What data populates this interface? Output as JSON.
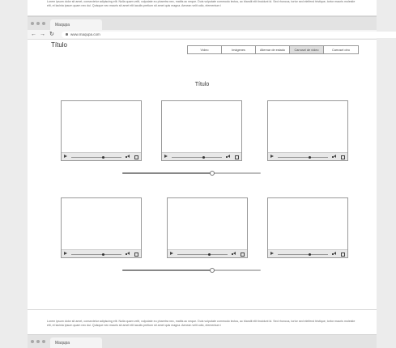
{
  "top_note": {
    "text": "Lorem ipsum dolor sit amet, consectetur adipiscing elit. Nulla quam velit, vulputate eu pharetra nec, mattis ac neque. Duis vulputate commodo lectus, ac blandit elit tincidunt id. Sed rhoncus, tortor sed eleifend tristique, tortor mauris molestie elit, et lacinia ipsum quam nec dui. Quisque nec mauris sit amet elit iaculis pretium sit amet quis magna. Aenean velit odio, elementum i"
  },
  "browser": {
    "tab_label": "Maqupa",
    "url": "www.maqupa.com",
    "back_icon": "back-arrow-icon",
    "forward_icon": "forward-arrow-icon",
    "reload_icon": "reload-icon"
  },
  "site": {
    "title": "Título",
    "nav": [
      {
        "label": "Vídeo",
        "active": false
      },
      {
        "label": "Imágenes",
        "active": false
      },
      {
        "label": "Alternar de estado",
        "active": false
      },
      {
        "label": "Carrusel de vídeo",
        "active": true
      },
      {
        "label": "Carrusel otro",
        "active": false
      }
    ]
  },
  "section": {
    "title": "Título"
  },
  "video_rows": [
    {
      "videos": [
        {
          "progress": 0.62
        },
        {
          "progress": 0.62
        },
        {
          "progress": 0.62
        }
      ],
      "slider_value": 0.65
    },
    {
      "videos": [
        {
          "progress": 0.62
        },
        {
          "progress": 0.62
        },
        {
          "progress": 0.62
        }
      ],
      "slider_value": 0.65
    }
  ],
  "footer": {
    "text": "Lorem ipsum dolor sit amet, consectetur adipiscing elit. Nulla quam velit, vulputate eu pharetra nec, mattis ac neque. Duis vulputate commodo lectus, ac blandit elit tincidunt id. Sed rhoncus, tortor sed eleifend tristique, tortor mauris molestie elit, et lacinia ipsum quam nec dui. Quisque nec mauris sit amet elit iaculis pretium sit amet quis magna. Aenean velit odio, elementum i"
  },
  "bottom_browser": {
    "tab_label": "Maqupa"
  }
}
